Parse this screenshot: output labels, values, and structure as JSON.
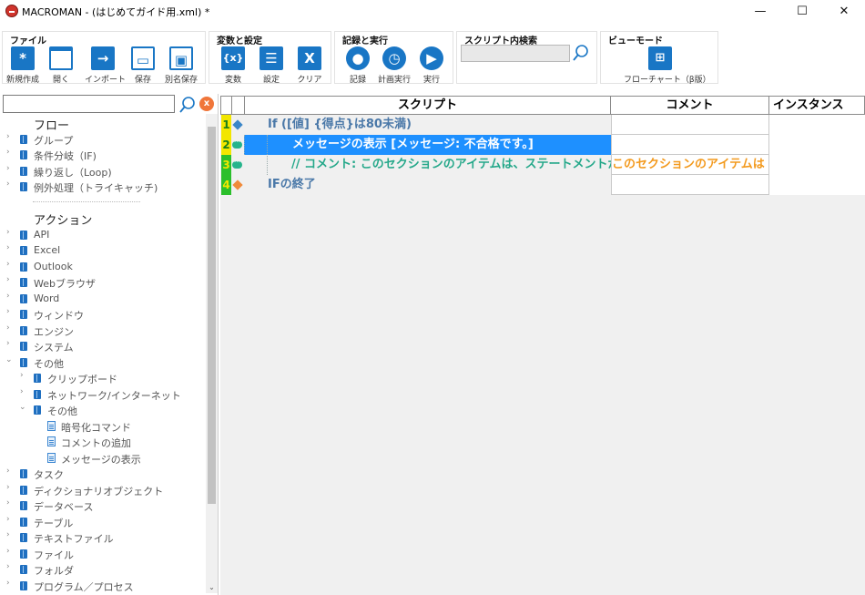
{
  "window": {
    "title": "MACROMAN - (はじめてガイド用.xml) *",
    "minimize": "—",
    "maximize": "☐",
    "close": "✕"
  },
  "ribbon": {
    "file": {
      "title": "ファイル",
      "new": "新規作成",
      "open": "開く",
      "import": "インポート",
      "save": "保存",
      "save_as": "別名保存"
    },
    "vars": {
      "title": "変数と設定",
      "variables": "変数",
      "settings": "設定",
      "clear": "クリア"
    },
    "record": {
      "title": "記録と実行",
      "record": "記録",
      "schedule": "計画実行",
      "run": "実行"
    },
    "search": {
      "title": "スクリプト内検索",
      "value": ""
    },
    "view": {
      "title": "ビューモード",
      "flowchart": "フローチャート（β版）"
    }
  },
  "tree": {
    "search_value": "",
    "clear_label": "x",
    "flow_heading": "フロー",
    "flow_items": [
      "グループ",
      "条件分岐（IF)",
      "繰り返し（Loop)",
      "例外処理（トライキャッチ)"
    ],
    "action_heading": "アクション",
    "action_items": [
      "API",
      "Excel",
      "Outlook",
      "Webブラウザ",
      "Word",
      "ウィンドウ",
      "エンジン",
      "システム",
      "その他"
    ],
    "other_children": [
      "クリップボード",
      "ネットワーク/インターネット",
      "その他"
    ],
    "other_leaves": [
      "暗号化コマンド",
      "コメントの追加",
      "メッセージの表示"
    ],
    "more_items": [
      "タスク",
      "ディクショナリオブジェクト",
      "データベース",
      "テーブル",
      "テキストファイル",
      "ファイル",
      "フォルダ",
      "プログラム／プロセス"
    ]
  },
  "grid": {
    "headers": {
      "script": "スクリプト",
      "comment": "コメント",
      "instance": "インスタンス"
    },
    "rows": [
      {
        "num": "1",
        "script": "If ([値] {得点}は80未満)",
        "comment": ""
      },
      {
        "num": "2",
        "script": "メッセージの表示 [メッセージ: 不合格です。]",
        "comment": ""
      },
      {
        "num": "3",
        "script": "// コメント: このセクションのアイテムは、ステートメントが",
        "comment": "このセクションのアイテムは"
      },
      {
        "num": "4",
        "script": "IFの終了",
        "comment": ""
      }
    ]
  },
  "colors": {
    "accent": "#1976c5",
    "selection": "#1e90ff",
    "comment_text": "#f39a1e",
    "keyword_blue": "#4a78a8",
    "comment_green": "#25a88a",
    "line_yellow": "#f2e600",
    "line_green": "#2bbf2b"
  }
}
